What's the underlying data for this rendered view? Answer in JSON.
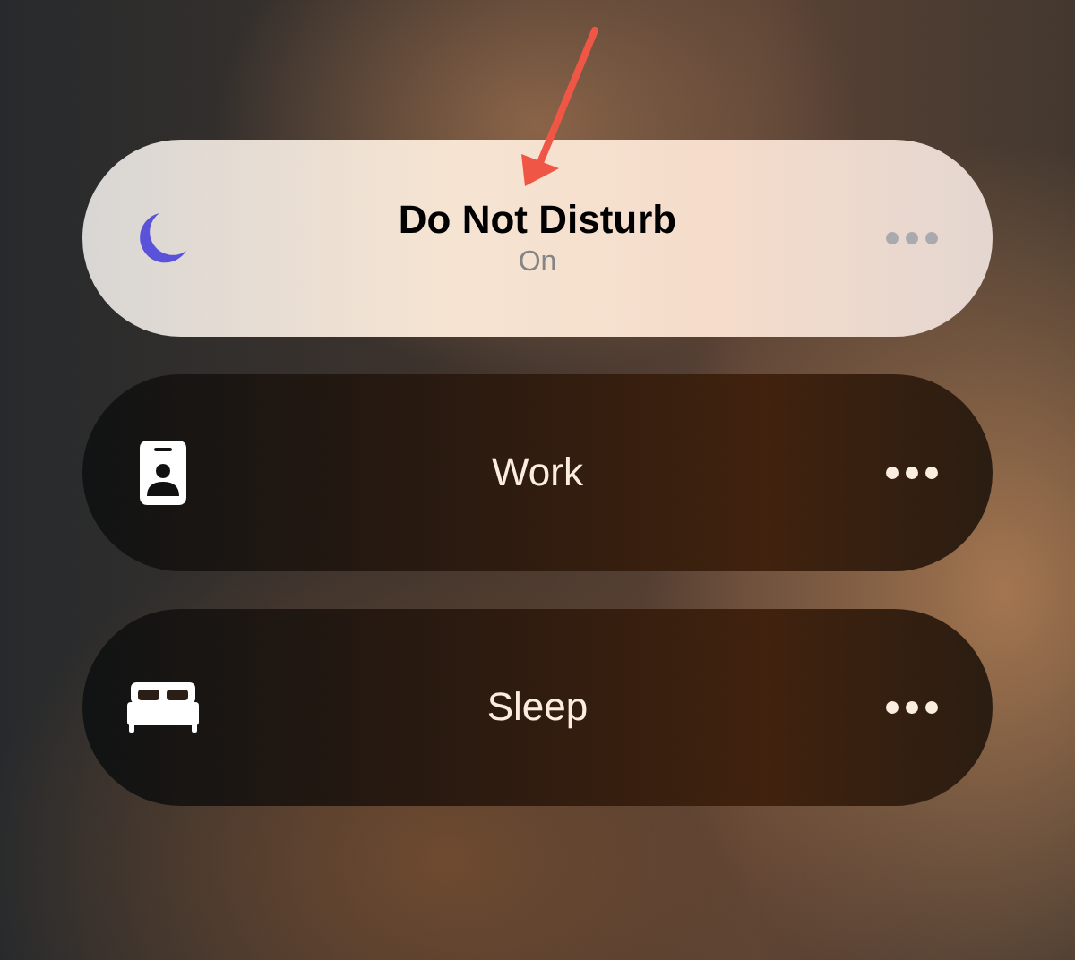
{
  "focus_modes": [
    {
      "kind": "moon",
      "label": "Do Not Disturb",
      "status": "On",
      "on": true
    },
    {
      "kind": "badge",
      "label": "Work",
      "on": false
    },
    {
      "kind": "bed",
      "label": "Sleep",
      "on": false
    }
  ]
}
